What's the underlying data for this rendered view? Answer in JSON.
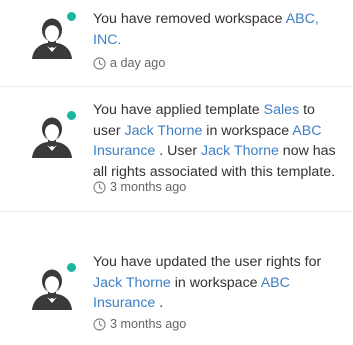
{
  "colors": {
    "link": "#3d7fc4",
    "status_online": "#1db59f",
    "text": "#333333",
    "muted": "#666666",
    "avatar_dark": "#3a3a3a"
  },
  "activity": [
    {
      "avatar_icon": "user-silhouette-icon",
      "status": "online",
      "message": [
        {
          "text": "You have removed workspace ",
          "link": false
        },
        {
          "text": "ABC, INC.",
          "link": true
        }
      ],
      "time_icon": "clock-icon",
      "time": "a day ago"
    },
    {
      "avatar_icon": "user-silhouette-icon",
      "status": "online",
      "message": [
        {
          "text": "You have applied template ",
          "link": false
        },
        {
          "text": "Sales",
          "link": true
        },
        {
          "text": " to user ",
          "link": false
        },
        {
          "text": "Jack Thorne",
          "link": true
        },
        {
          "text": " in workspace ",
          "link": false
        },
        {
          "text": "ABC Insurance",
          "link": true
        },
        {
          "text": " . User ",
          "link": false
        },
        {
          "text": "Jack Thorne",
          "link": true
        },
        {
          "text": " now has all rights associated with this template.",
          "link": false
        }
      ],
      "time_icon": "clock-icon",
      "time": "3 months ago"
    },
    {
      "avatar_icon": "user-silhouette-icon",
      "status": "online",
      "message": [
        {
          "text": "You have updated the user rights for ",
          "link": false
        },
        {
          "text": "Jack Thorne",
          "link": true
        },
        {
          "text": " in workspace ",
          "link": false
        },
        {
          "text": "ABC Insurance",
          "link": true
        },
        {
          "text": " .",
          "link": false
        }
      ],
      "time_icon": "clock-icon",
      "time": "3 months ago"
    }
  ]
}
